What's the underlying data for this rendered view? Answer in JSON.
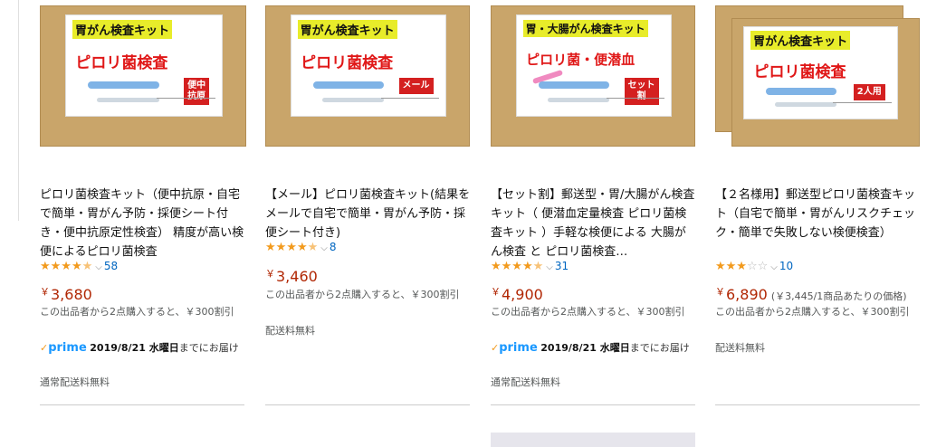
{
  "products": [
    {
      "image": {
        "line1": "胃がん検査キット",
        "line2": "ピロリ菌検査",
        "badge": "便中\n抗原"
      },
      "title": "ピロリ菌検査キット（便中抗原・自宅で簡単・胃がん予防・採便シート付き・便中抗原定性検査） 精度が高い検便によるピロリ菌検査",
      "stars": 4.5,
      "review_count": "58",
      "price": "3,680",
      "unit_price": "",
      "bulk_note": "この出品者から2点購入すると、￥300割引",
      "prime_label": "prime",
      "delivery_date": "2019/8/21 水曜日",
      "delivery_suffix": "までにお届け",
      "shipping": "通常配送料無料"
    },
    {
      "image": {
        "line1": "胃がん検査キット",
        "line2": "ピロリ菌検査",
        "badge": "メール"
      },
      "title": "【メール】ピロリ菌検査キット(結果をメールで自宅で簡単・胃がん予防・採便シート付き)",
      "stars": 4.5,
      "review_count": "8",
      "price": "3,460",
      "unit_price": "",
      "bulk_note": "この出品者から2点購入すると、￥300割引",
      "prime_label": "",
      "delivery_date": "",
      "delivery_suffix": "",
      "shipping": "配送料無料"
    },
    {
      "image": {
        "line1": "胃・大腸がん検査キット",
        "line2": "ピロリ菌・便潜血",
        "badge": "セット\n割"
      },
      "title": "【セット割】郵送型・胃/大腸がん検査キット（ 便潜血定量検査 ピロリ菌検査キット ）手軽な検便による 大腸がん検査 と ピロリ菌検査…",
      "stars": 4.5,
      "review_count": "31",
      "price": "4,900",
      "unit_price": "",
      "bulk_note": "この出品者から2点購入すると、￥300割引",
      "prime_label": "prime",
      "delivery_date": "2019/8/21 水曜日",
      "delivery_suffix": "までにお届け",
      "shipping": "通常配送料無料"
    },
    {
      "image": {
        "line1": "胃がん検査キット",
        "line2": "ピロリ菌検査",
        "badge": "2人用"
      },
      "title": "【２名様用】郵送型ピロリ菌検査キット（自宅で簡単・胃がんリスクチェック・簡単で失敗しない検便検査）",
      "stars": 3.0,
      "review_count": "10",
      "price": "6,890",
      "unit_price": "(￥3,445/1商品あたりの価格)",
      "bulk_note": "この出品者から2点購入すると、￥300割引",
      "prime_label": "",
      "delivery_date": "",
      "delivery_suffix": "",
      "shipping": "配送料無料"
    }
  ],
  "currency_symbol": "￥",
  "colors": {
    "price": "#b12704",
    "star": "#f29a1d",
    "link": "#0066c0",
    "prime": "#1a98ff",
    "package": "#c9a56a"
  }
}
